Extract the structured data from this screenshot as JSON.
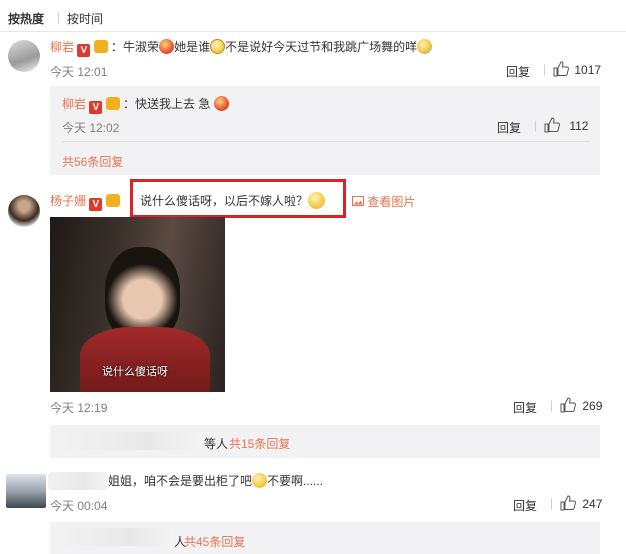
{
  "sort": {
    "hot": "按热度",
    "separator": "|",
    "time": "按时间"
  },
  "comments": [
    {
      "user": "柳岩",
      "text_a": "：牛淑荣",
      "text_b": "她是谁",
      "text_c": "不是说好今天过节和我跳广场舞的咩",
      "time": "今天 12:01",
      "reply_label": "回复",
      "likes": "1017",
      "sub_reply": {
        "user": "柳岩",
        "text": "：快送我上去 急",
        "time": "今天 12:02",
        "reply_label": "回复",
        "likes": "112",
        "more": "共56条回复"
      }
    },
    {
      "user": "杨子姗",
      "text": "说什么傻话呀，以后不嫁人啦？",
      "view_image": "查看图片",
      "image_caption": "说什么傻话呀",
      "time": "今天 12:19",
      "reply_label": "回复",
      "likes": "269",
      "more_prefix": "等人",
      "more": "共15条回复"
    },
    {
      "text_a": "姐姐，咱不会是要出柜了吧",
      "text_b": "不要啊......",
      "time": "今天 00:04",
      "reply_label": "回复",
      "likes": "247",
      "more_prefix": "人",
      "more": "共45条回复"
    }
  ]
}
